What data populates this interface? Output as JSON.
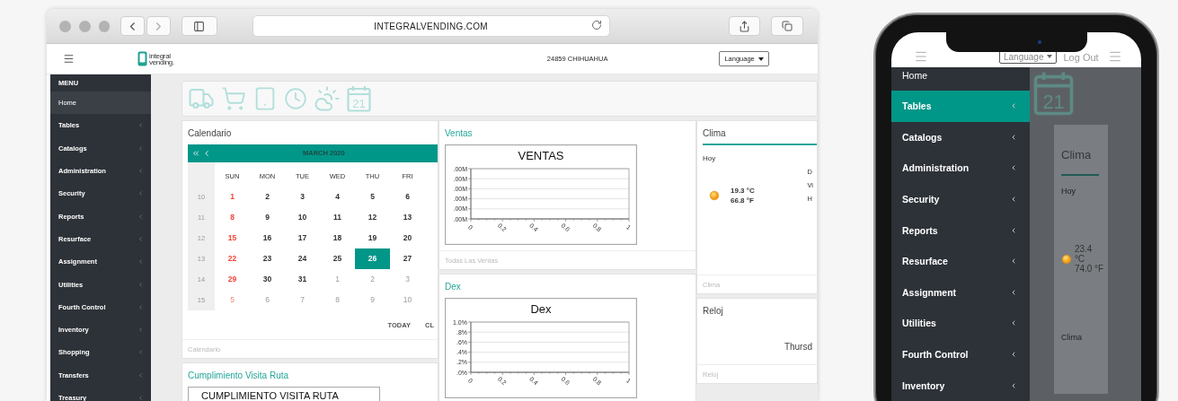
{
  "browser": {
    "url": "INTEGRALVENDING.COM"
  },
  "app_header": {
    "logo": {
      "line1": "integral",
      "line2": "vending."
    },
    "location": "24859 CHIHUAHUA",
    "language": "Language"
  },
  "sidebar": {
    "heading": "MENU",
    "items": [
      {
        "label": "Home",
        "kind": "link",
        "selected": true
      },
      {
        "label": "Tables",
        "kind": "submenu",
        "selected": false
      },
      {
        "label": "Catalogs",
        "kind": "submenu",
        "selected": false
      },
      {
        "label": "Administration",
        "kind": "submenu",
        "selected": false
      },
      {
        "label": "Security",
        "kind": "submenu",
        "selected": false
      },
      {
        "label": "Reports",
        "kind": "submenu",
        "selected": false
      },
      {
        "label": "Resurface",
        "kind": "submenu",
        "selected": false
      },
      {
        "label": "Assignment",
        "kind": "submenu",
        "selected": false
      },
      {
        "label": "Utilities",
        "kind": "submenu",
        "selected": false
      },
      {
        "label": "Fourth Control",
        "kind": "submenu",
        "selected": false
      },
      {
        "label": "Inventory",
        "kind": "submenu",
        "selected": false
      },
      {
        "label": "Shopping",
        "kind": "submenu",
        "selected": false
      },
      {
        "label": "Transfers",
        "kind": "submenu",
        "selected": false
      },
      {
        "label": "Treasury",
        "kind": "submenu",
        "selected": false
      }
    ]
  },
  "toolbar": {
    "calendar_day": "21"
  },
  "calendar_widget": {
    "title": "Calendario",
    "highlighted": false,
    "month": "MARCH 2020",
    "weekdays": [
      "SUN",
      "MON",
      "TUE",
      "WED",
      "THU",
      "FRI"
    ],
    "weeks": [
      {
        "number": "10",
        "days": [
          {
            "label": "1",
            "muted": false,
            "selected": false
          },
          {
            "label": "2",
            "muted": false,
            "selected": false
          },
          {
            "label": "3",
            "muted": false,
            "selected": false
          },
          {
            "label": "4",
            "muted": false,
            "selected": false
          },
          {
            "label": "5",
            "muted": false,
            "selected": false
          },
          {
            "label": "6",
            "muted": false,
            "selected": false
          }
        ]
      },
      {
        "number": "11",
        "days": [
          {
            "label": "8",
            "muted": false,
            "selected": false
          },
          {
            "label": "9",
            "muted": false,
            "selected": false
          },
          {
            "label": "10",
            "muted": false,
            "selected": false
          },
          {
            "label": "11",
            "muted": false,
            "selected": false
          },
          {
            "label": "12",
            "muted": false,
            "selected": false
          },
          {
            "label": "13",
            "muted": false,
            "selected": false
          }
        ]
      },
      {
        "number": "12",
        "days": [
          {
            "label": "15",
            "muted": false,
            "selected": false
          },
          {
            "label": "16",
            "muted": false,
            "selected": false
          },
          {
            "label": "17",
            "muted": false,
            "selected": false
          },
          {
            "label": "18",
            "muted": false,
            "selected": false
          },
          {
            "label": "19",
            "muted": false,
            "selected": false
          },
          {
            "label": "20",
            "muted": false,
            "selected": false
          }
        ]
      },
      {
        "number": "13",
        "days": [
          {
            "label": "22",
            "muted": false,
            "selected": false
          },
          {
            "label": "23",
            "muted": false,
            "selected": false
          },
          {
            "label": "24",
            "muted": false,
            "selected": false
          },
          {
            "label": "25",
            "muted": false,
            "selected": false
          },
          {
            "label": "26",
            "muted": false,
            "selected": true
          },
          {
            "label": "27",
            "muted": false,
            "selected": false
          }
        ]
      },
      {
        "number": "14",
        "days": [
          {
            "label": "29",
            "muted": false,
            "selected": false
          },
          {
            "label": "30",
            "muted": false,
            "selected": false
          },
          {
            "label": "31",
            "muted": false,
            "selected": false
          },
          {
            "label": "1",
            "muted": true,
            "selected": false
          },
          {
            "label": "2",
            "muted": true,
            "selected": false
          },
          {
            "label": "3",
            "muted": true,
            "selected": false
          }
        ]
      },
      {
        "number": "15",
        "days": [
          {
            "label": "5",
            "muted": true,
            "selected": false
          },
          {
            "label": "6",
            "muted": true,
            "selected": false
          },
          {
            "label": "7",
            "muted": true,
            "selected": false
          },
          {
            "label": "8",
            "muted": true,
            "selected": false
          },
          {
            "label": "9",
            "muted": true,
            "selected": false
          },
          {
            "label": "10",
            "muted": true,
            "selected": false
          }
        ]
      }
    ],
    "buttons": [
      "TODAY",
      "CL"
    ],
    "footer": "Calendario"
  },
  "cumplimiento_widget": {
    "title": "Cumplimiento Visita Ruta",
    "highlighted": true,
    "chart_title": "CUMPLIMIENTO VISITA RUTA"
  },
  "ventas_widget": {
    "title": "Ventas",
    "highlighted": true,
    "chart_data": {
      "type": "line",
      "title": "VENTAS",
      "grid": true,
      "xlim": [
        0,
        1
      ],
      "xticks": [
        0,
        0.2,
        0.4,
        0.6,
        0.8,
        1
      ],
      "ylim": [
        0,
        5
      ],
      "yticks": [
        {
          "value": 0,
          "label": ".00M"
        },
        {
          "value": 1,
          "label": ".00M"
        },
        {
          "value": 2,
          "label": ".00M"
        },
        {
          "value": 3,
          "label": ".00M"
        },
        {
          "value": 4,
          "label": ".00M"
        },
        {
          "value": 5,
          "label": ".00M"
        }
      ]
    },
    "footer": "Todas Las Ventas"
  },
  "dex_widget": {
    "title": "Dex",
    "highlighted": true,
    "chart_data": {
      "type": "line",
      "title": "Dex",
      "grid": true,
      "xlim": [
        0,
        1
      ],
      "xticks": [
        0,
        0.2,
        0.4,
        0.6,
        0.8,
        1
      ],
      "ylim": [
        0,
        1
      ],
      "yticks": [
        {
          "value": 0,
          "label": ".0%"
        },
        {
          "value": 0.2,
          "label": ".2%"
        },
        {
          "value": 0.4,
          "label": ".4%"
        },
        {
          "value": 0.6,
          "label": ".6%"
        },
        {
          "value": 0.8,
          "label": ".8%"
        },
        {
          "value": 1,
          "label": "1.0%"
        }
      ]
    }
  },
  "clima_widget": {
    "title": "Clima",
    "highlighted": false,
    "today": "Hoy",
    "celsius": "19.3 °C",
    "fahrenheit": "66.8 °F",
    "details": [
      "D",
      "Vi",
      "H"
    ],
    "footer": "Clima"
  },
  "reloj_widget": {
    "title": "Reloj",
    "highlighted": false,
    "day": "Thursd",
    "footer": "Reloj"
  },
  "phone": {
    "header": {
      "language": "Language",
      "logout": "Log Out"
    },
    "menu": [
      {
        "label": "Home",
        "kind": "link",
        "selected": false
      },
      {
        "label": "Tables",
        "kind": "submenu",
        "selected": true
      },
      {
        "label": "Catalogs",
        "kind": "submenu",
        "selected": false
      },
      {
        "label": "Administration",
        "kind": "submenu",
        "selected": false
      },
      {
        "label": "Security",
        "kind": "submenu",
        "selected": false
      },
      {
        "label": "Reports",
        "kind": "submenu",
        "selected": false
      },
      {
        "label": "Resurface",
        "kind": "submenu",
        "selected": false
      },
      {
        "label": "Assignment",
        "kind": "submenu",
        "selected": false
      },
      {
        "label": "Utilities",
        "kind": "submenu",
        "selected": false
      },
      {
        "label": "Fourth Control",
        "kind": "submenu",
        "selected": false
      },
      {
        "label": "Inventory",
        "kind": "submenu",
        "selected": false
      }
    ],
    "background": {
      "calendar_day": "21",
      "title": "Clima",
      "today": "Hoy",
      "celsius": "23.4 °C",
      "fahrenheit": "74.0 °F",
      "footer": "Clima"
    }
  }
}
